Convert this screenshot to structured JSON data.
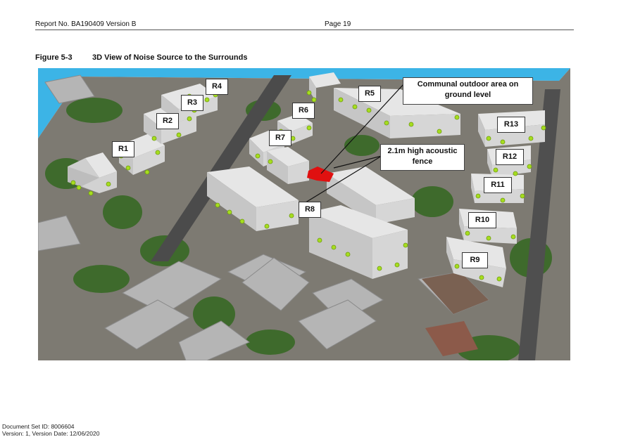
{
  "header": {
    "report_number": "Report No. BA190409 Version B",
    "page": "Page 19"
  },
  "figure": {
    "number": "Figure 5-3",
    "title": "3D View of Noise Source to the Surrounds",
    "receivers": [
      "R1",
      "R2",
      "R3",
      "R4",
      "R5",
      "R6",
      "R7",
      "R8",
      "R9",
      "R10",
      "R11",
      "R12",
      "R13"
    ],
    "callouts": {
      "outdoor_area": "Communal outdoor area on ground level",
      "fence": "2.1m high acoustic fence"
    },
    "colors": {
      "noise_source": "#e01010",
      "receiver_points": "#a6dd1f",
      "buildings": "#d9d9d9",
      "sky": "#3cb4e6",
      "vegetation": "#3e6a2c"
    }
  },
  "footer": {
    "doc_id": "Document Set ID: 8006604",
    "version": "Version: 1, Version Date: 12/06/2020"
  }
}
